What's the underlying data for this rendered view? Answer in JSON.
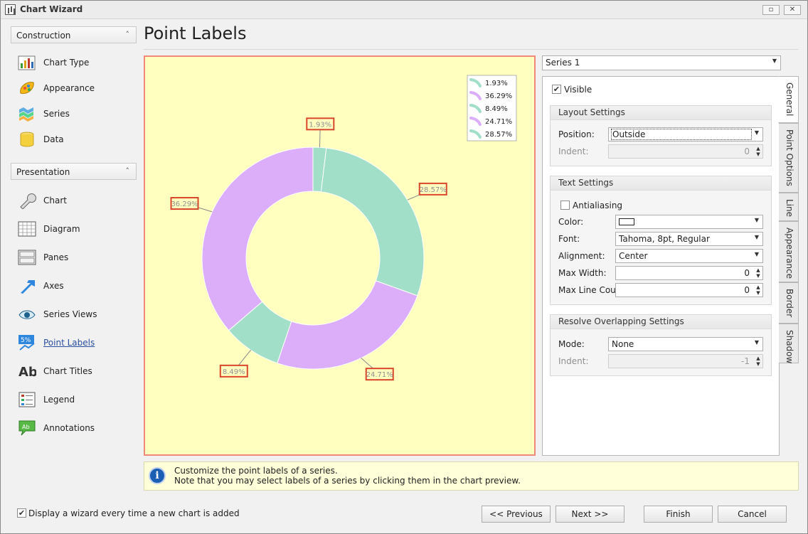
{
  "window": {
    "title": "Chart Wizard",
    "restore_glyph": "▫",
    "close_glyph": "✕"
  },
  "sidebar": {
    "construction_header": "Construction",
    "construction_items": [
      {
        "label": "Chart Type",
        "icon": "chart-type-icon"
      },
      {
        "label": "Appearance",
        "icon": "appearance-icon"
      },
      {
        "label": "Series",
        "icon": "series-icon"
      },
      {
        "label": "Data",
        "icon": "data-icon"
      }
    ],
    "presentation_header": "Presentation",
    "presentation_items": [
      {
        "label": "Chart",
        "icon": "wrench-icon"
      },
      {
        "label": "Diagram",
        "icon": "diagram-icon"
      },
      {
        "label": "Panes",
        "icon": "panes-icon"
      },
      {
        "label": "Axes",
        "icon": "axes-arrow-icon"
      },
      {
        "label": "Series Views",
        "icon": "series-views-icon"
      },
      {
        "label": "Point Labels",
        "icon": "point-labels-icon",
        "badge": "5%"
      },
      {
        "label": "Chart Titles",
        "icon": "chart-titles-icon",
        "badge": "Ab"
      },
      {
        "label": "Legend",
        "icon": "legend-icon"
      },
      {
        "label": "Annotations",
        "icon": "annotations-icon",
        "badge": "Ab"
      }
    ],
    "collapse_glyph": "˄"
  },
  "page": {
    "title": "Point Labels"
  },
  "chart_data": {
    "type": "pie",
    "variant": "doughnut",
    "slices": [
      {
        "label": "1.93%",
        "value": 1.93,
        "color": "#a2dfc8"
      },
      {
        "label": "28.57%",
        "value": 28.57,
        "color": "#a2dfc8"
      },
      {
        "label": "24.71%",
        "value": 24.71,
        "color": "#dcaefa"
      },
      {
        "label": "8.49%",
        "value": 8.49,
        "color": "#a2dfc8"
      },
      {
        "label": "36.29%",
        "value": 36.29,
        "color": "#dcaefa"
      }
    ],
    "legend": {
      "placement": "top-right",
      "entries": [
        {
          "label": "1.93%",
          "color": "#a2dfc8"
        },
        {
          "label": "36.29%",
          "color": "#dcaefa"
        },
        {
          "label": "8.49%",
          "color": "#a2dfc8"
        },
        {
          "label": "24.71%",
          "color": "#dcaefa"
        },
        {
          "label": "28.57%",
          "color": "#a2dfc8"
        }
      ]
    },
    "label_position": "Outside",
    "background": "#ffffc0",
    "label_border_color": "#d9472b"
  },
  "series_selector": {
    "value": "Series 1"
  },
  "tabs": [
    {
      "label": "General",
      "selected": true
    },
    {
      "label": "Point Options"
    },
    {
      "label": "Line"
    },
    {
      "label": "Appearance"
    },
    {
      "label": "Border"
    },
    {
      "label": "Shadow"
    }
  ],
  "general": {
    "visible_label": "Visible",
    "visible_checked": true,
    "layout_header": "Layout Settings",
    "position_label": "Position:",
    "position_value": "Outside",
    "indent_label": "Indent:",
    "indent_value": "0",
    "text_header": "Text Settings",
    "antialiasing_label": "Antialiasing",
    "antialiasing_checked": false,
    "color_label": "Color:",
    "color_value": "#ffffff",
    "font_label": "Font:",
    "font_value": "Tahoma, 8pt, Regular",
    "alignment_label": "Alignment:",
    "alignment_value": "Center",
    "maxwidth_label": "Max Width:",
    "maxwidth_value": "0",
    "maxline_label": "Max Line Count:",
    "maxline_value": "0",
    "resolve_header": "Resolve Overlapping Settings",
    "mode_label": "Mode:",
    "mode_value": "None",
    "indent2_label": "Indent:",
    "indent2_value": "-1"
  },
  "info": {
    "line1": "Customize the point labels of a series.",
    "line2": "Note that you may select labels of a series by clicking them in the chart preview.",
    "icon_glyph": "i"
  },
  "footer": {
    "show_wizard_label": "Display a wizard every time a new chart is added",
    "show_wizard_checked": true,
    "previous": "<< Previous",
    "next": "Next >>",
    "finish": "Finish",
    "cancel": "Cancel"
  }
}
